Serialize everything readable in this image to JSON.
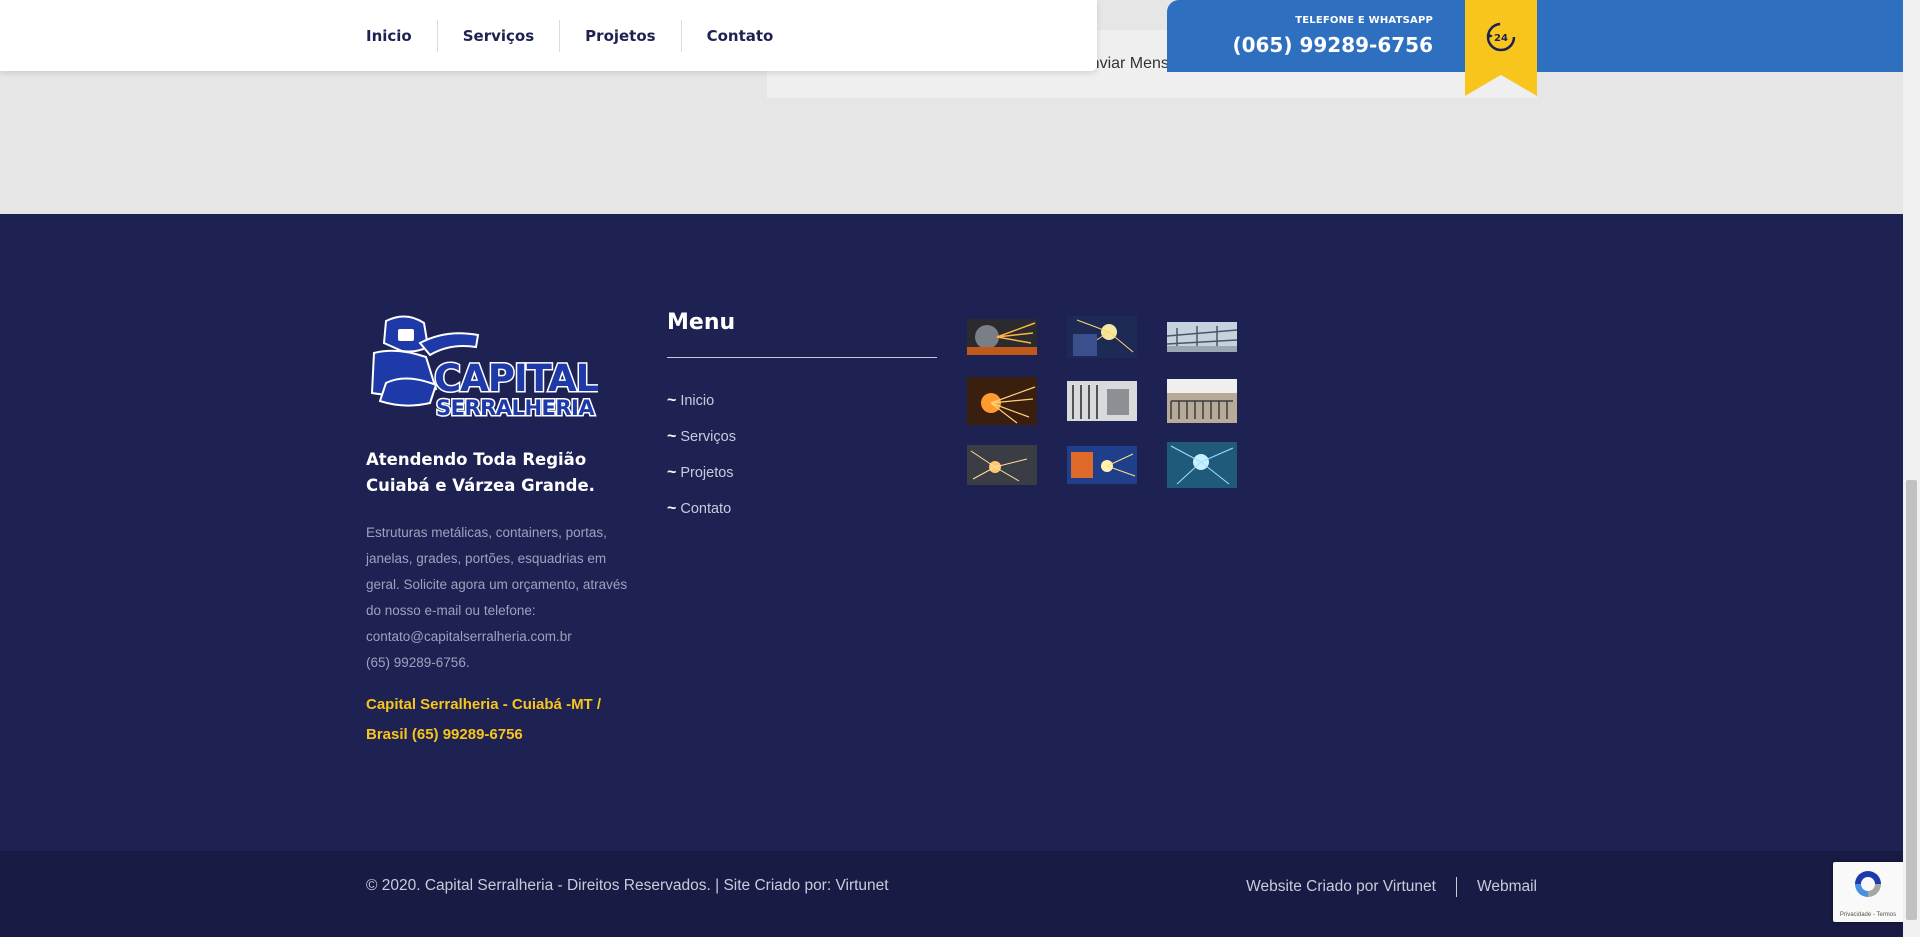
{
  "nav": {
    "items": [
      {
        "label": "Inicio"
      },
      {
        "label": "Serviços"
      },
      {
        "label": "Projetos"
      },
      {
        "label": "Contato"
      }
    ]
  },
  "phone": {
    "label": "TELEFONE E WHATSAPP",
    "number": "(065) 99289-6756",
    "badge": "24"
  },
  "form": {
    "submit_label": "Enviar Mensagem"
  },
  "footer": {
    "logo": {
      "line1": "CAPITAL",
      "line2": "SERRALHERIA"
    },
    "tagline": "Atendendo Toda Região Cuiabá e Várzea Grande.",
    "about": [
      "Estruturas metálicas, containers, portas,",
      "janelas, grades, portões, esquadrias em",
      "geral. Solicite agora um orçamento, através",
      "do nosso e-mail ou telefone:",
      "contato@capitalserralheria.com.br",
      "(65) 99289-6756."
    ],
    "address": "Capital Serralheria - Cuiabá -MT / Brasil (65) 99289-6756",
    "menu_title": "Menu",
    "menu_items": [
      {
        "label": "Inicio"
      },
      {
        "label": "Serviços"
      },
      {
        "label": "Projetos"
      },
      {
        "label": "Contato"
      }
    ],
    "gallery_icon": "welding-photo-thumbnail"
  },
  "bottom": {
    "copyright": "© 2020. Capital Serralheria - Direitos Reservados. | Site Criado por: Virtunet",
    "credit_link": "Website Criado por Virtunet",
    "webmail_link": "Webmail"
  },
  "recaptcha": {
    "text": "Privacidade - Termos"
  },
  "colors": {
    "footer_bg": "#1e2252",
    "bottom_bg": "#181b44",
    "accent_yellow": "#f7c51c",
    "phone_blue": "#2e6fbf"
  }
}
